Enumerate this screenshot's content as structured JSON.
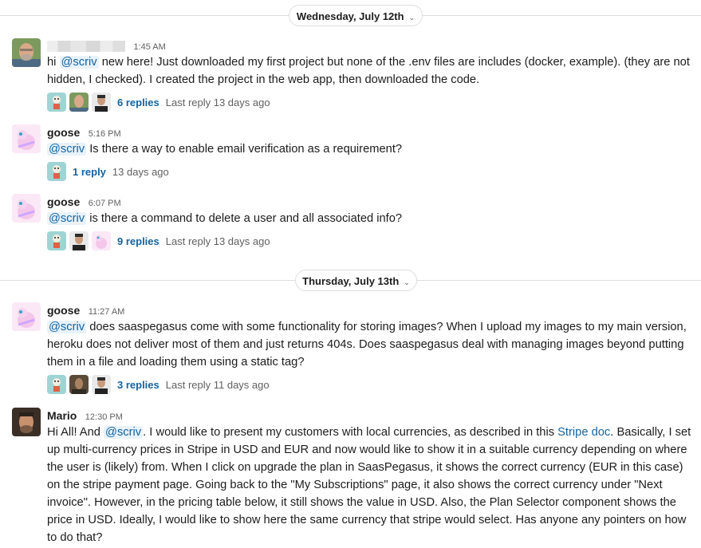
{
  "days": [
    {
      "label": "Wednesday, July 12th"
    },
    {
      "label": "Thursday, July 13th"
    }
  ],
  "messages": [
    {
      "author": "",
      "time": "1:45 AM",
      "segments": [
        {
          "t": "hi "
        },
        {
          "t": "@scriv",
          "type": "mention"
        },
        {
          "t": " new here! Just downloaded my first project but none of the .env files are includes (docker, example). (they are not hidden, I checked). I created the project in the web app, then downloaded the code."
        }
      ],
      "thread": {
        "replies": "6 replies",
        "last": "Last reply 13 days ago"
      }
    },
    {
      "author": "goose",
      "time": "5:16 PM",
      "segments": [
        {
          "t": "@scriv",
          "type": "mention"
        },
        {
          "t": " Is there a way to enable email verification as a requirement?"
        }
      ],
      "thread": {
        "replies": "1 reply",
        "last": "13 days ago"
      }
    },
    {
      "author": "goose",
      "time": "6:07 PM",
      "segments": [
        {
          "t": "@scriv",
          "type": "mention"
        },
        {
          "t": " is there a command to delete a user and all associated info?"
        }
      ],
      "thread": {
        "replies": "9 replies",
        "last": "Last reply 13 days ago"
      }
    },
    {
      "author": "goose",
      "time": "11:27 AM",
      "segments": [
        {
          "t": "@scriv",
          "type": "mention"
        },
        {
          "t": " does saaspegasus come with some functionality for storing images? When I upload my images to my main version, heroku does not deliver most of them and just returns 404s. Does saaspegasus deal with managing images beyond putting them in a file and loading them using a static tag?"
        }
      ],
      "thread": {
        "replies": "3 replies",
        "last": "Last reply 11 days ago"
      }
    },
    {
      "author": "Mario",
      "time": "12:30 PM",
      "segments": [
        {
          "t": "Hi All! And "
        },
        {
          "t": "@scriv",
          "type": "mention"
        },
        {
          "t": ". I would like to present my customers with local currencies, as described in this "
        },
        {
          "t": "Stripe doc",
          "type": "link"
        },
        {
          "t": ". Basically, I set up multi-currency prices in Stripe in USD and EUR and now would like to show it in a suitable currency depending on where the user is (likely) from. When I click on upgrade the plan in SaasPegasus, it shows the correct currency (EUR in this case) on the stripe payment page. Going back to the \"My Subscriptions\" page, it also shows the correct currency under \"Next invoice\". However, in the pricing table below, it still shows the value in USD. Also, the Plan Selector component shows the price in USD. Ideally, I would like to show here the same currency that stripe would select. Has anyone any pointers on how to do that?"
        }
      ]
    }
  ]
}
